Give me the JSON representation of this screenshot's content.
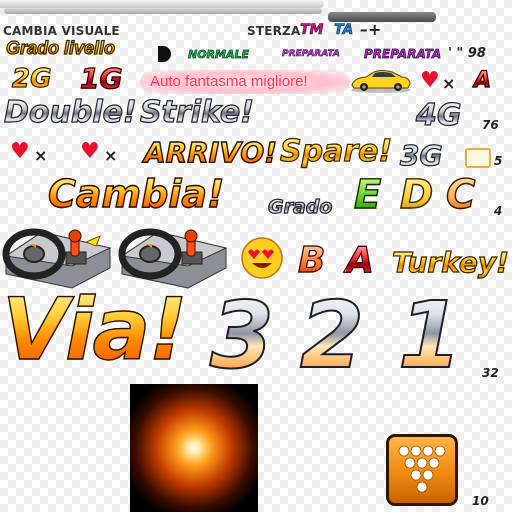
{
  "header": {
    "cambia_visuale": "CAMBIA VISUALE",
    "sterza": "STERZA",
    "tm": "TM",
    "ta": "TA",
    "minus_plus": "–+"
  },
  "grado_livello": "Grado livello",
  "modes": {
    "normale": "NORMALE",
    "preparata_1": "PREPARATA",
    "preparata_2": "PREPARATA"
  },
  "time_marks": "' \" 98",
  "gears": {
    "g2": "2G",
    "g1": "1G",
    "g4": "4G",
    "g3": "3G"
  },
  "auto_fantasma": "Auto fantasma migliore!",
  "a_letter": "A",
  "double": "Double!",
  "strike": "Strike!",
  "num_76": "76",
  "arrivo": "ARRIVO!",
  "spare": "Spare!",
  "num_5": "5",
  "cambia": "Cambia!",
  "grado": "Grado",
  "grades_top": [
    "E",
    "D",
    "C"
  ],
  "num_4": "4",
  "grades_bottom": [
    "B",
    "A"
  ],
  "turkey": "Turkey!",
  "via": "Via!",
  "countdown": [
    "3",
    "2",
    "1"
  ],
  "num_32": "32",
  "num_10": "10",
  "colors": {
    "heart": "#e8132b",
    "gold": "#ffd43a",
    "fire": "#ff8a00",
    "normale_green": "#0a8a3a",
    "preparata_purple": "#7a1f8f",
    "tile_orange": "#f08a10"
  }
}
